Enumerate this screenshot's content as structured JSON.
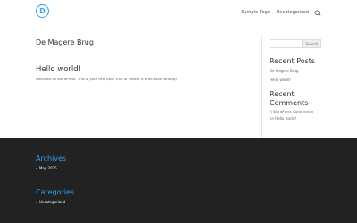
{
  "header": {
    "logo_letter": "D",
    "nav": [
      {
        "label": "Sample Page"
      },
      {
        "label": "Uncategorized"
      }
    ],
    "search_icon": "search-icon"
  },
  "main": {
    "page_title": "De Magere Brug",
    "post": {
      "title": "Hello world!",
      "excerpt": "Welcome to WordPress. This is your first post. Edit or delete it, then start writing!"
    }
  },
  "sidebar": {
    "search": {
      "value": "",
      "button_label": "Search"
    },
    "recent_posts": {
      "heading": "Recent Posts",
      "items": [
        "De Magere Brug",
        "Hello world!"
      ]
    },
    "recent_comments": {
      "heading_line1": "Recent",
      "heading_line2": "Comments",
      "items": [
        {
          "author": "A WordPress Commenter",
          "connector": "on",
          "post": "Hello world!"
        }
      ]
    }
  },
  "footer": {
    "archives": {
      "heading": "Archives",
      "items": [
        "May 2025"
      ]
    },
    "categories": {
      "heading": "Categories",
      "items": [
        "Uncategorized"
      ]
    }
  },
  "colors": {
    "accent": "#2ea3f2",
    "footer_bg": "#222222",
    "heading": "#333333",
    "text": "#666666"
  }
}
